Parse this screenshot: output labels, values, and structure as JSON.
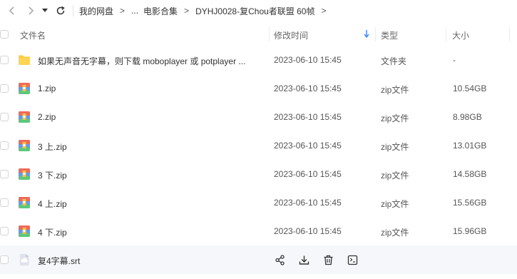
{
  "breadcrumb": {
    "items": [
      "我的网盘",
      "...",
      "电影合集",
      "DYHJ0028-复Chou者联盟 60帧"
    ],
    "separator": ">"
  },
  "columns": {
    "name": "文件名",
    "modified": "修改时间",
    "type": "类型",
    "size": "大小"
  },
  "rows": [
    {
      "name": "如果无声音无字幕，则下载 moboplayer 或 potplayer ...",
      "date": "2023-06-10 15:45",
      "type": "文件夹",
      "size": "-",
      "icon": "folder-icon"
    },
    {
      "name": "1.zip",
      "date": "2023-06-10 15:45",
      "type": "zip文件",
      "size": "10.54GB",
      "icon": "zip-archive-icon"
    },
    {
      "name": "2.zip",
      "date": "2023-06-10 15:45",
      "type": "zip文件",
      "size": "8.98GB",
      "icon": "zip-archive-icon"
    },
    {
      "name": "3 上.zip",
      "date": "2023-06-10 15:45",
      "type": "zip文件",
      "size": "13.01GB",
      "icon": "zip-archive-icon"
    },
    {
      "name": "3 下.zip",
      "date": "2023-06-10 15:45",
      "type": "zip文件",
      "size": "14.58GB",
      "icon": "zip-archive-icon"
    },
    {
      "name": "4 上.zip",
      "date": "2023-06-10 15:45",
      "type": "zip文件",
      "size": "15.56GB",
      "icon": "zip-archive-icon"
    },
    {
      "name": "4 下.zip",
      "date": "2023-06-10 15:45",
      "type": "zip文件",
      "size": "15.96GB",
      "icon": "zip-archive-icon"
    },
    {
      "name": "复4字幕.srt",
      "icon": "subtitle-file-icon"
    }
  ],
  "colors": {
    "sort_arrow": "#3b82f6",
    "folder": "#ffcb3d",
    "hover_row": "#f6f7fa"
  }
}
